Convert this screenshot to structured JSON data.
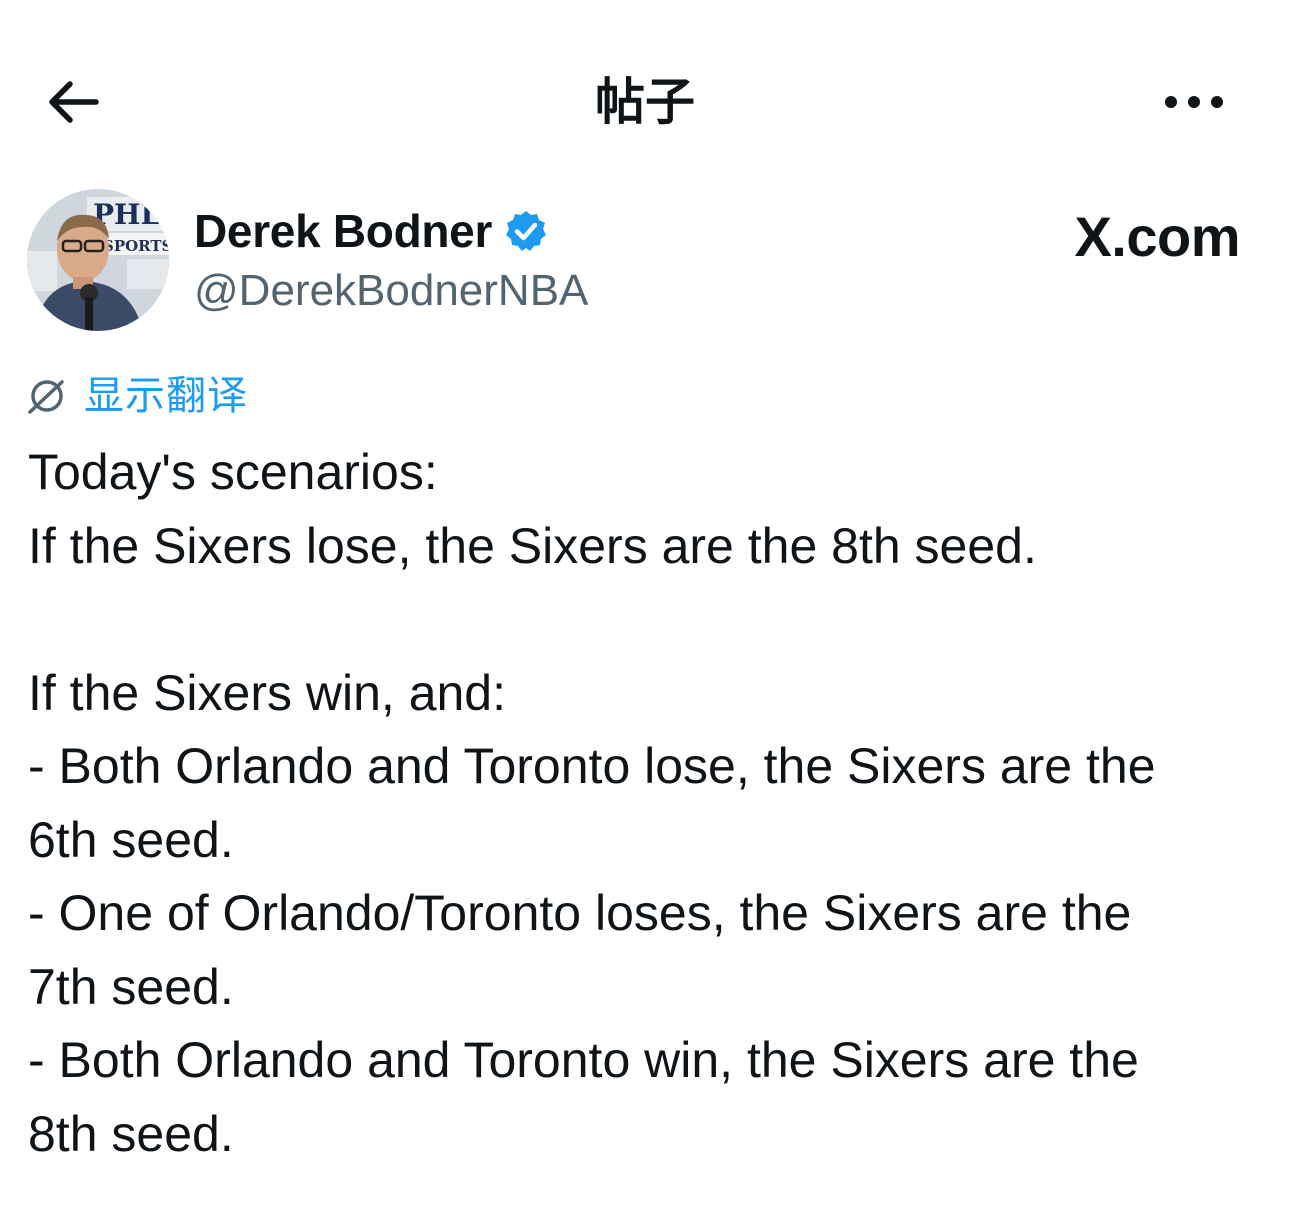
{
  "header": {
    "title": "帖子"
  },
  "author": {
    "name": "Derek Bodner",
    "handle": "@DerekBodnerNBA",
    "verified": true,
    "avatar_text_1": "PHL",
    "avatar_text_2": "SPORTS"
  },
  "brand": "X.com",
  "translate": {
    "label": "显示翻译"
  },
  "post": {
    "lines": [
      "Today's scenarios:",
      "If the Sixers lose, the Sixers are the 8th seed.",
      "",
      "If the Sixers win, and:",
      "- Both Orlando and Toronto lose, the Sixers are the",
      "6th seed.",
      "- One of Orlando/Toronto loses, the Sixers are the",
      "7th seed.",
      "- Both Orlando and Toronto win, the Sixers are the",
      "8th seed."
    ]
  },
  "colors": {
    "accent": "#1d9bf0",
    "text": "#0f1419",
    "secondary": "#536471"
  },
  "icons": [
    "arrow-left-icon",
    "more-horizontal-icon",
    "verified-badge-icon",
    "translate-icon"
  ]
}
